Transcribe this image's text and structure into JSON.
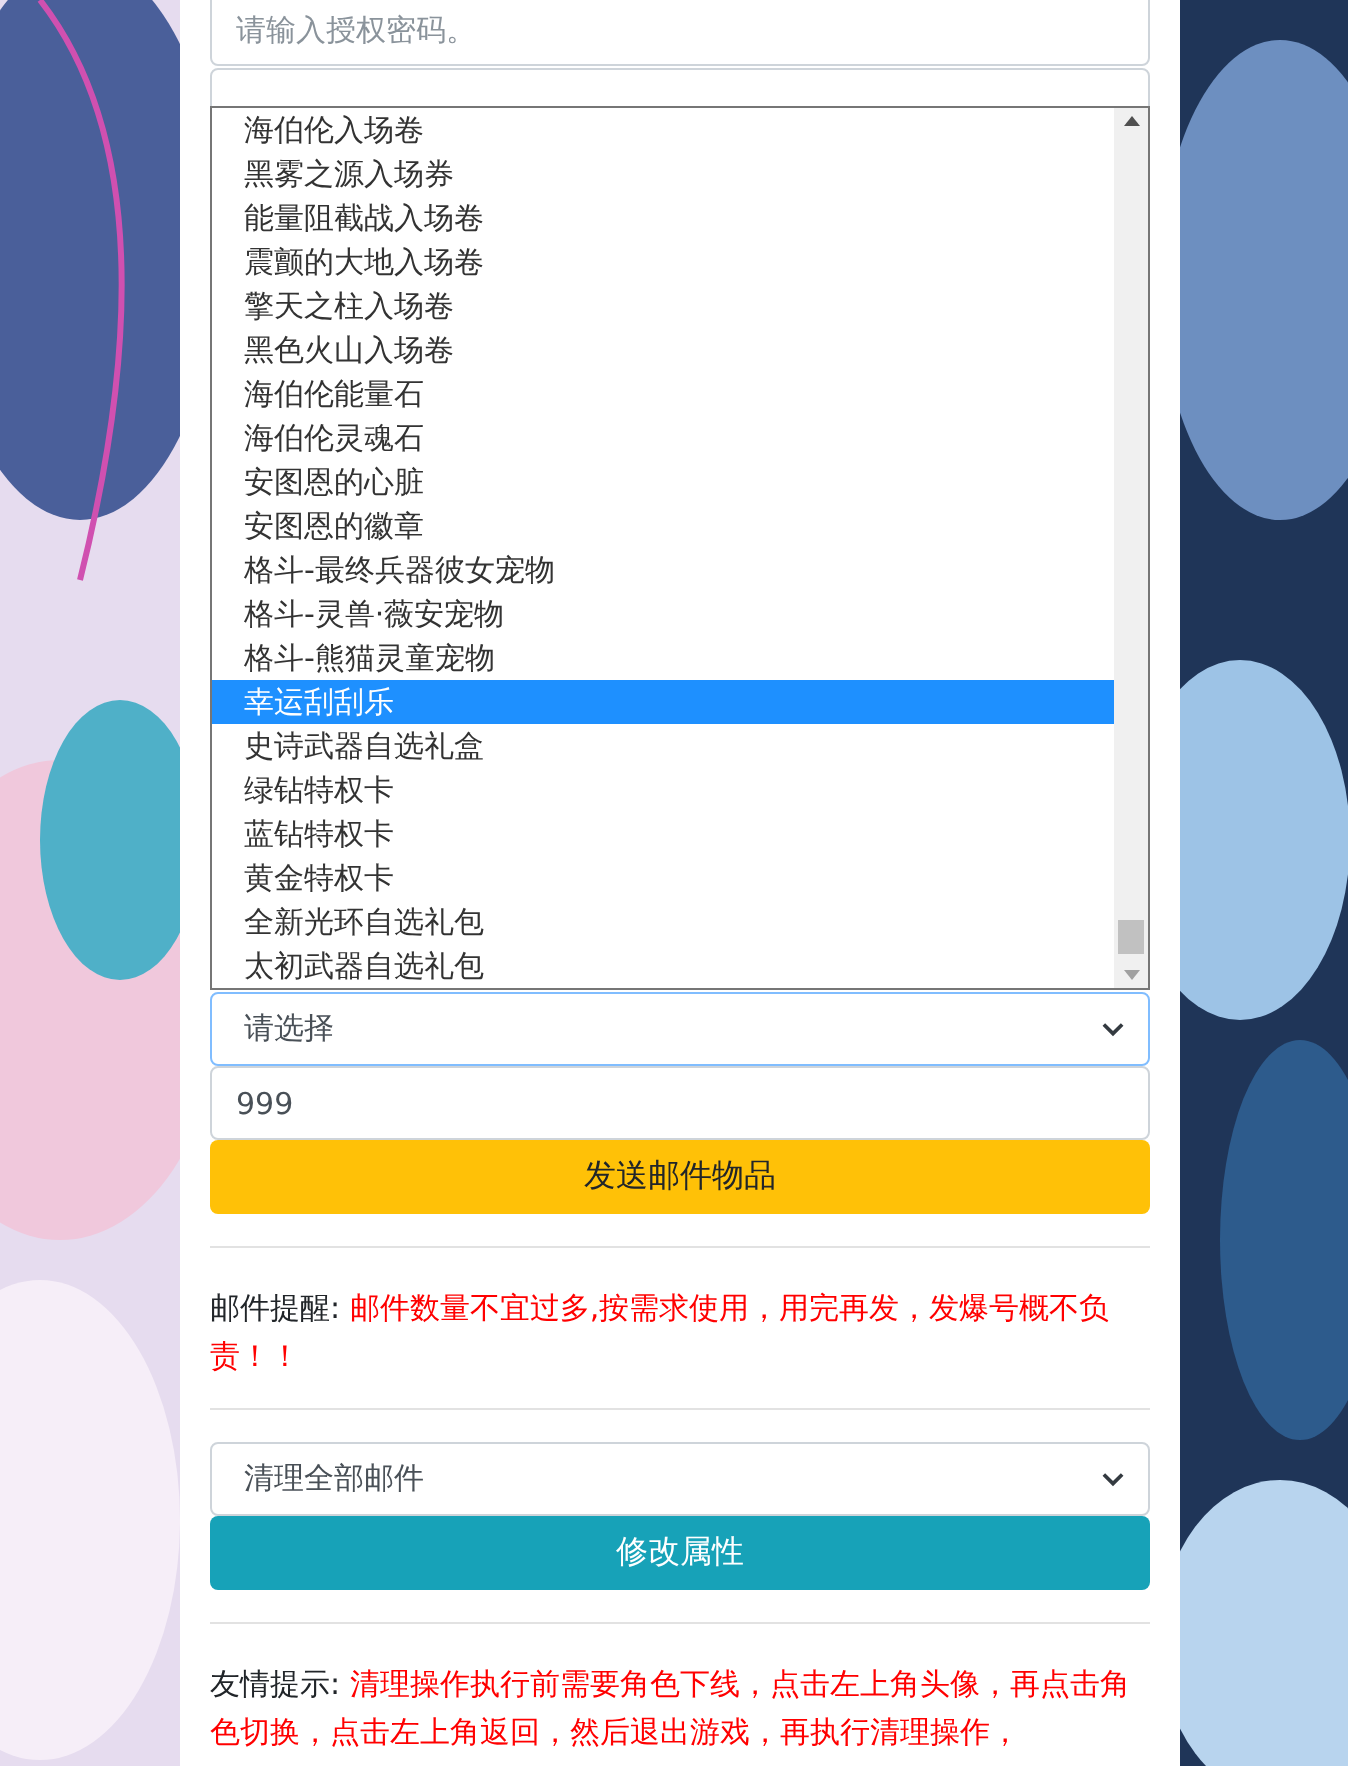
{
  "auth_field": {
    "placeholder": "请输入授权密码。"
  },
  "item_select": {
    "value": "请选择",
    "options": [
      {
        "label": "海伯伦入场卷",
        "selected": false
      },
      {
        "label": "黑雾之源入场券",
        "selected": false
      },
      {
        "label": "能量阻截战入场卷",
        "selected": false
      },
      {
        "label": "震颤的大地入场卷",
        "selected": false
      },
      {
        "label": "擎天之柱入场卷",
        "selected": false
      },
      {
        "label": "黑色火山入场卷",
        "selected": false
      },
      {
        "label": "海伯伦能量石",
        "selected": false
      },
      {
        "label": "海伯伦灵魂石",
        "selected": false
      },
      {
        "label": "安图恩的心脏",
        "selected": false
      },
      {
        "label": "安图恩的徽章",
        "selected": false
      },
      {
        "label": "格斗-最终兵器彼女宠物",
        "selected": false
      },
      {
        "label": "格斗-灵兽·薇安宠物",
        "selected": false
      },
      {
        "label": "格斗-熊猫灵童宠物",
        "selected": false
      },
      {
        "label": "幸运刮刮乐",
        "selected": true
      },
      {
        "label": "史诗武器自选礼盒",
        "selected": false
      },
      {
        "label": "绿钻特权卡",
        "selected": false
      },
      {
        "label": "蓝钻特权卡",
        "selected": false
      },
      {
        "label": "黄金特权卡",
        "selected": false
      },
      {
        "label": "全新光环自选礼包",
        "selected": false
      },
      {
        "label": "太初武器自选礼包",
        "selected": false
      }
    ]
  },
  "quantity_field": {
    "value": "999"
  },
  "send_button": "发送邮件物品",
  "mail_notice": {
    "label": "邮件提醒:",
    "text": "邮件数量不宜过多,按需求使用，用完再发，发爆号概不负责！！"
  },
  "clear_select": {
    "value": "清理全部邮件"
  },
  "modify_button": "修改属性",
  "tip": {
    "label": "友情提示:",
    "text": "清理操作执行前需要角色下线，点击左上角头像，再点击角色切换，点击左上角返回，然后退出游戏，再执行清理操作，"
  }
}
